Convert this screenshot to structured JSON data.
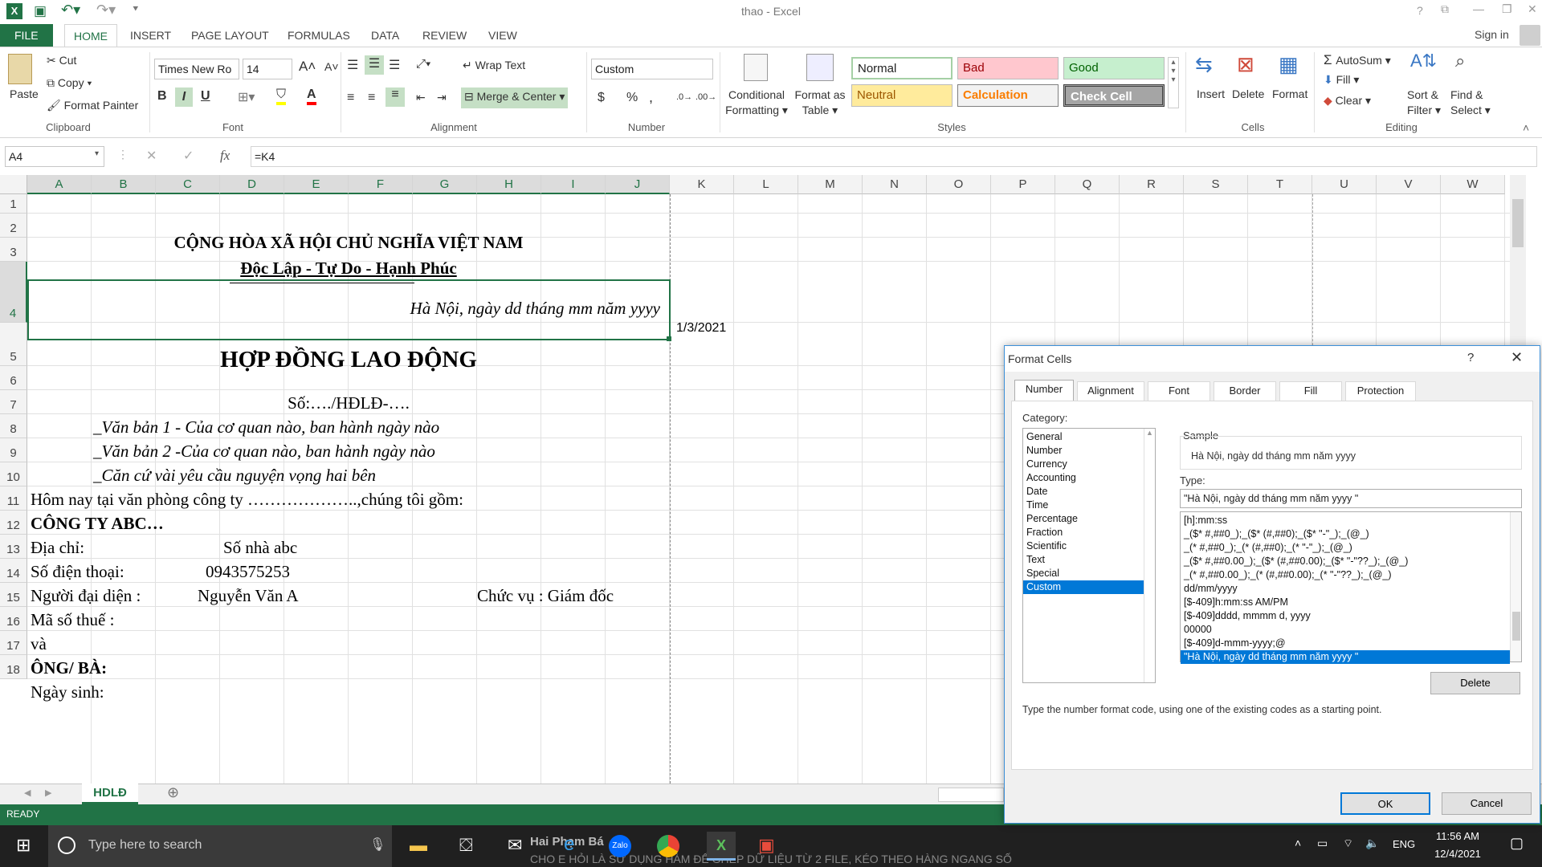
{
  "titlebar": {
    "title": "thao - Excel",
    "help": "?",
    "signin": "Sign in"
  },
  "tabs": [
    "FILE",
    "HOME",
    "INSERT",
    "PAGE LAYOUT",
    "FORMULAS",
    "DATA",
    "REVIEW",
    "VIEW"
  ],
  "ribbon": {
    "clipboard": {
      "paste": "Paste",
      "cut": "Cut",
      "copy": "Copy",
      "painter": "Format Painter",
      "label": "Clipboard"
    },
    "font": {
      "name": "Times New Ro",
      "size": "14",
      "bold": "B",
      "italic": "I",
      "underline": "U",
      "label": "Font"
    },
    "alignment": {
      "wrap": "Wrap Text",
      "merge": "Merge & Center",
      "label": "Alignment"
    },
    "number": {
      "format": "Custom",
      "dollar": "$",
      "percent": "%",
      "comma": ",",
      "label": "Number"
    },
    "styles": {
      "cond1": "Conditional",
      "cond2": "Formatting",
      "table1": "Format as",
      "table2": "Table",
      "normal": "Normal",
      "bad": "Bad",
      "good": "Good",
      "neutral": "Neutral",
      "calculation": "Calculation",
      "check": "Check Cell",
      "label": "Styles"
    },
    "cells": {
      "insert": "Insert",
      "delete": "Delete",
      "format": "Format",
      "label": "Cells"
    },
    "editing": {
      "autosum": "AutoSum",
      "fill": "Fill",
      "clear": "Clear",
      "sort1": "Sort &",
      "sort2": "Filter",
      "find1": "Find &",
      "find2": "Select",
      "label": "Editing"
    }
  },
  "formula": {
    "namebox": "A4",
    "fx": "fx",
    "value": "=K4"
  },
  "columns": [
    "A",
    "B",
    "C",
    "D",
    "E",
    "F",
    "G",
    "H",
    "I",
    "J",
    "K",
    "L",
    "M",
    "N",
    "O",
    "P",
    "Q",
    "R",
    "S",
    "T",
    "U",
    "V",
    "W"
  ],
  "rows": [
    "1",
    "2",
    "3",
    "4",
    "5",
    "6",
    "7",
    "8",
    "9",
    "10",
    "11",
    "12",
    "13",
    "14",
    "15",
    "16",
    "17",
    "18"
  ],
  "cells": {
    "r2": "CỘNG HÒA XÃ HỘI CHỦ NGHĨA VIỆT NAM",
    "r3": "Độc Lập - Tự Do - Hạnh Phúc",
    "r4": "Hà Nội, ngày dd tháng mm năm yyyy",
    "k4": "1/3/2021",
    "r5": "HỢP ĐỒNG LAO ĐỘNG",
    "r6": "Số:…./HĐLĐ-….",
    "r7": "_Văn bản 1 - Của cơ quan nào, ban hành ngày nào",
    "r8": "_Văn bản 2 -Của cơ quan nào, ban hành ngày nào",
    "r9": "_Căn cứ vài yêu cầu nguyện vọng hai bên",
    "r10": "Hôm nay tại văn phòng công ty ………………..,chúng tôi gồm:",
    "r11": "CÔNG TY ABC…",
    "r12a": "Địa chỉ:",
    "r12d": "Số nhà abc",
    "r13a": "Số điện thoại:",
    "r13d": "0943575253",
    "r14a": "Người đại diện :",
    "r14c": "Nguyễn Văn A",
    "r14h": "Chức vụ : Giám đốc",
    "r15": "Mã số thuế :",
    "r16": "và",
    "r17": "ÔNG/ BÀ:",
    "r18": "Ngày sinh:"
  },
  "sheet": {
    "tab": "HDLĐ",
    "status": "READY"
  },
  "taskbar": {
    "search": "Type here to search",
    "lang": "ENG",
    "time": "11:56 AM",
    "date": "12/4/2021",
    "bg_text1": "Hai Phạm Bá",
    "bg_text2": "CHO E HỎI LÀ SỬ DỤNG HÀM ĐỂ GHÉP DỮ LIỆU TỪ 2 FILE, KÉO THEO HÀNG NGANG SỐ"
  },
  "dialog": {
    "title": "Format Cells",
    "help": "?",
    "close": "✕",
    "tabs": [
      "Number",
      "Alignment",
      "Font",
      "Border",
      "Fill",
      "Protection"
    ],
    "category_label": "Category:",
    "categories": [
      "General",
      "Number",
      "Currency",
      "Accounting",
      "Date",
      "Time",
      "Percentage",
      "Fraction",
      "Scientific",
      "Text",
      "Special",
      "Custom"
    ],
    "sample_label": "Sample",
    "sample": "Hà Nội, ngày dd tháng mm năm yyyy",
    "type_label": "Type:",
    "type_value": "\"Hà Nội, ngày dd tháng mm năm yyyy \"",
    "formats": [
      "[h]:mm:ss",
      "_($* #,##0_);_($* (#,##0);_($* \"-\"_);_(@_)",
      "_(* #,##0_);_(* (#,##0);_(* \"-\"_);_(@_)",
      "_($* #,##0.00_);_($* (#,##0.00);_($* \"-\"??_);_(@_)",
      "_(* #,##0.00_);_(* (#,##0.00);_(* \"-\"??_);_(@_)",
      "dd/mm/yyyy",
      "[$-409]h:mm:ss AM/PM",
      "[$-409]dddd, mmmm d, yyyy",
      "00000",
      "[$-409]d-mmm-yyyy;@",
      "\"Hà Nội, ngày dd tháng mm năm yyyy \""
    ],
    "delete": "Delete",
    "hint": "Type the number format code, using one of the existing codes as a starting point.",
    "ok": "OK",
    "cancel": "Cancel"
  }
}
